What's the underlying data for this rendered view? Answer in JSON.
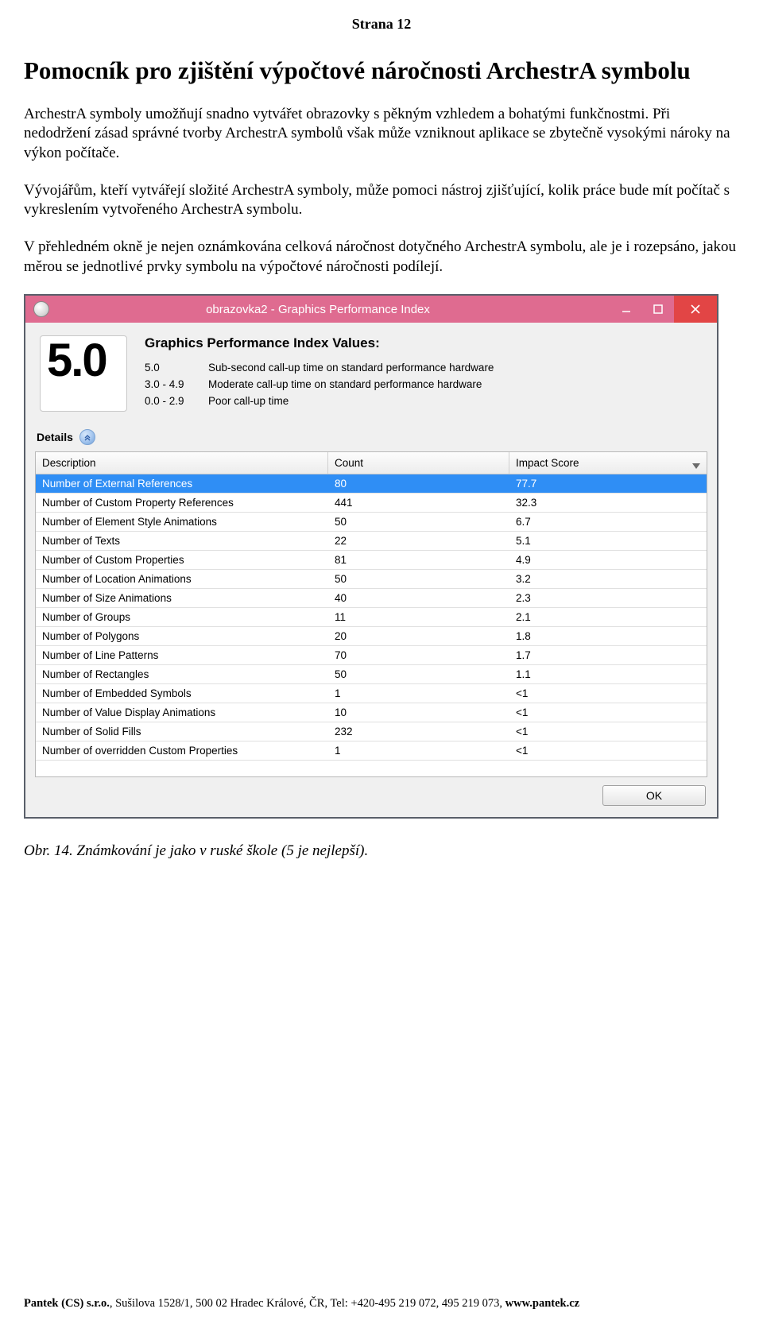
{
  "page_label": "Strana 12",
  "title": "Pomocník pro zjištění výpočtové náročnosti ArchestrA symbolu",
  "paragraphs": [
    "ArchestrA symboly umožňují snadno vytvářet obrazovky s pěkným vzhledem a bohatými funkčnostmi. Při nedodržení zásad správné tvorby ArchestrA symbolů však může vzniknout aplikace se zbytečně vysokými nároky na výkon počítače.",
    "Vývojářům, kteří vytvářejí složité ArchestrA symboly, může pomoci nástroj zjišťující, kolik práce bude mít počítač s vykreslením vytvořeného ArchestrA symbolu.",
    "V přehledném okně je nejen oznámkována celková náročnost dotyčného ArchestrA symbolu, ale je i rozepsáno, jakou měrou se jednotlivé prvky symbolu na výpočtové náročnosti podílejí."
  ],
  "window": {
    "title": "obrazovka2 - Graphics Performance Index",
    "score": "5.0",
    "heading": "Graphics Performance Index Values:",
    "legend": [
      {
        "range": "5.0",
        "desc": "Sub-second call-up time on standard performance hardware"
      },
      {
        "range": "3.0 - 4.9",
        "desc": "Moderate call-up time on standard performance hardware"
      },
      {
        "range": "0.0 - 2.9",
        "desc": "Poor call-up time"
      }
    ],
    "details_label": "Details",
    "columns": {
      "desc": "Description",
      "count": "Count",
      "score": "Impact Score"
    },
    "rows": [
      {
        "desc": "Number of External References",
        "count": "80",
        "score": "77.7",
        "selected": true
      },
      {
        "desc": "Number of Custom Property References",
        "count": "441",
        "score": "32.3"
      },
      {
        "desc": "Number of Element Style Animations",
        "count": "50",
        "score": "6.7"
      },
      {
        "desc": "Number of Texts",
        "count": "22",
        "score": "5.1"
      },
      {
        "desc": "Number of Custom Properties",
        "count": "81",
        "score": "4.9"
      },
      {
        "desc": "Number of Location Animations",
        "count": "50",
        "score": "3.2"
      },
      {
        "desc": "Number of Size Animations",
        "count": "40",
        "score": "2.3"
      },
      {
        "desc": "Number of Groups",
        "count": "11",
        "score": "2.1"
      },
      {
        "desc": "Number of Polygons",
        "count": "20",
        "score": "1.8"
      },
      {
        "desc": "Number of Line Patterns",
        "count": "70",
        "score": "1.7"
      },
      {
        "desc": "Number of Rectangles",
        "count": "50",
        "score": "1.1"
      },
      {
        "desc": "Number of Embedded Symbols",
        "count": "1",
        "score": "<1"
      },
      {
        "desc": "Number of Value Display Animations",
        "count": "10",
        "score": "<1"
      },
      {
        "desc": "Number of Solid Fills",
        "count": "232",
        "score": "<1"
      },
      {
        "desc": "Number of overridden Custom Properties",
        "count": "1",
        "score": "<1"
      }
    ],
    "ok_label": "OK"
  },
  "caption": "Obr. 14. Známkování je jako v ruské škole (5 je nejlepší).",
  "footer": {
    "company": "Pantek (CS) s.r.o.",
    "rest": ", Sušilova 1528/1, 500 02 Hradec Králové, ČR, Tel: +420-495 219 072, 495 219 073, ",
    "site": "www.pantek.cz"
  }
}
